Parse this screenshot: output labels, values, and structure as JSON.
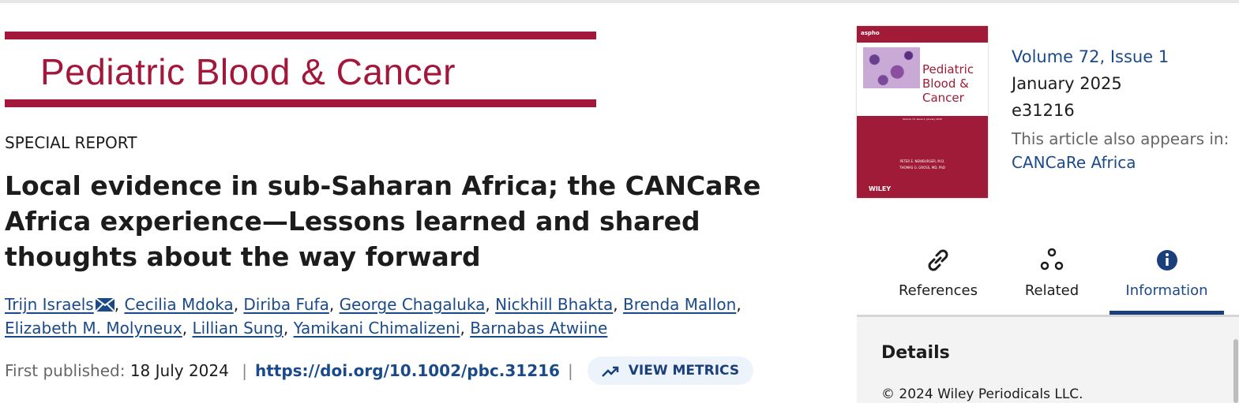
{
  "journal": {
    "banner_title": "Pediatric Blood & Cancer",
    "brand_color": "#a3173a"
  },
  "article": {
    "type": "SPECIAL REPORT",
    "title": "Local evidence in sub-Saharan Africa; the CANCaRe Africa experience—Lessons learned and shared thoughts about the way forward",
    "authors": [
      {
        "name": "Trijn Israels",
        "icon": "envelope-icon"
      },
      {
        "name": "Cecilia Mdoka"
      },
      {
        "name": "Diriba Fufa"
      },
      {
        "name": "George Chagaluka"
      },
      {
        "name": "Nickhill Bhakta"
      },
      {
        "name": "Brenda Mallon"
      },
      {
        "name": "Elizabeth M. Molyneux"
      },
      {
        "name": "Lillian Sung"
      },
      {
        "name": "Yamikani Chimalizeni"
      },
      {
        "name": "Barnabas Atwiine"
      }
    ],
    "first_published_label": "First published:",
    "first_published_date": "18 July 2024",
    "separator": "|",
    "doi": "https://doi.org/10.1002/pbc.31216",
    "metrics_label": "VIEW METRICS",
    "metrics_icon": "trending-up-icon"
  },
  "cover": {
    "society": "aspho",
    "title": "Pediatric Blood & Cancer",
    "volume_line": "Volume 72, Issue 1, January 2025",
    "editors": [
      "PETER E. NEWBURGER, M.D.",
      "THOMAS G. GROSS, MD, PhD"
    ],
    "publisher": "WILEY"
  },
  "issue": {
    "volume": "Volume 72, Issue 1",
    "date": "January 2025",
    "eid": "e31216",
    "also_appears_label": "This article also appears in:",
    "collection": "CANCaRe Africa"
  },
  "tabs": [
    {
      "label": "References",
      "icon": "link-icon",
      "active": false
    },
    {
      "label": "Related",
      "icon": "related-nodes-icon",
      "active": false
    },
    {
      "label": "Information",
      "icon": "info-icon",
      "active": true
    }
  ],
  "panel": {
    "heading": "Details",
    "copyright": "© 2024 Wiley Periodicals LLC."
  },
  "colors": {
    "link": "#1b4a8a",
    "active_tab": "#1b3f7a",
    "metrics_bg": "#ecf3fb"
  }
}
